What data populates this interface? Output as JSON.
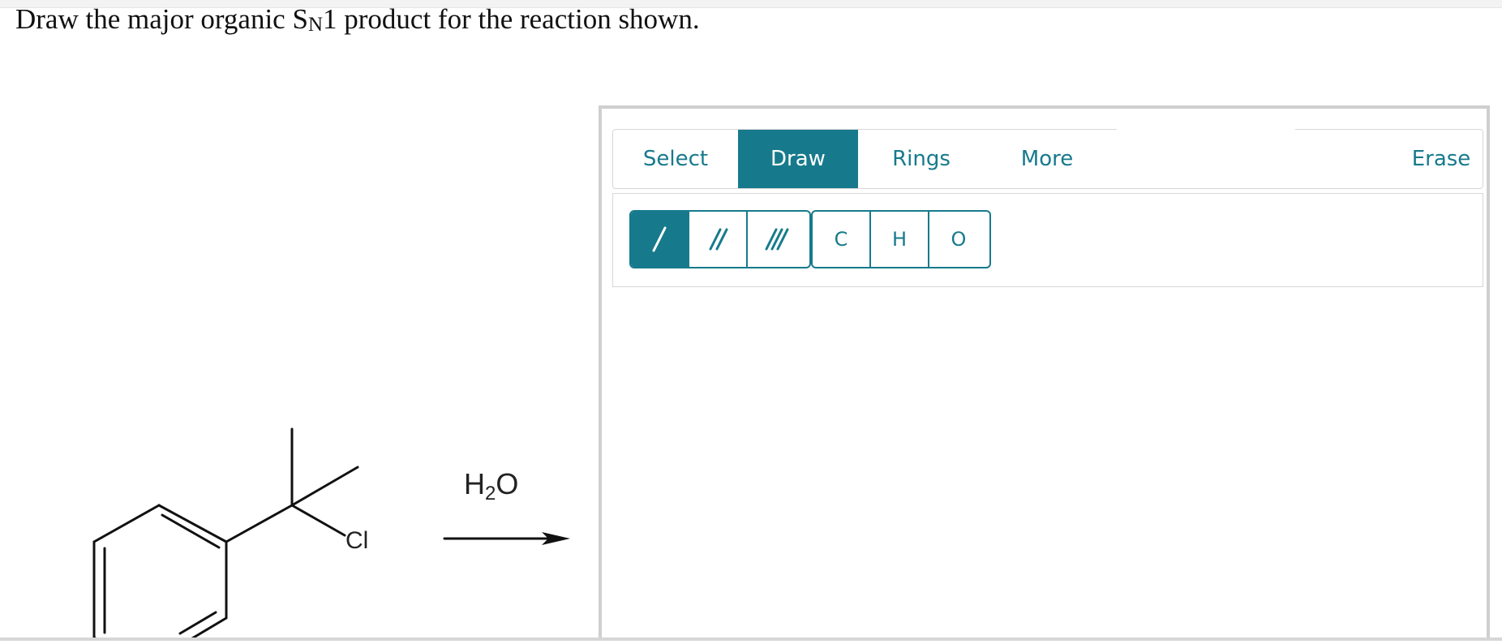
{
  "question": {
    "prefix": "Draw the major organic ",
    "sn_s": "S",
    "sn_n": "N",
    "suffix": "1 product for the reaction shown."
  },
  "reaction": {
    "reagent_h": "H",
    "reagent_sub": "2",
    "reagent_o": "O",
    "leaving_group": "Cl"
  },
  "editor": {
    "tabs": [
      {
        "label": "Select",
        "active": false
      },
      {
        "label": "Draw",
        "active": true
      },
      {
        "label": "Rings",
        "active": false
      },
      {
        "label": "More",
        "active": false
      },
      {
        "label": "Erase",
        "active": false
      }
    ],
    "bond_tools": [
      {
        "icon": "single-bond-icon",
        "active": true
      },
      {
        "icon": "double-bond-icon",
        "active": false
      },
      {
        "icon": "triple-bond-icon",
        "active": false
      }
    ],
    "atom_tools": [
      "C",
      "H",
      "O"
    ]
  },
  "colors": {
    "accent": "#177a8c",
    "panel_border": "#cfcfcf"
  }
}
